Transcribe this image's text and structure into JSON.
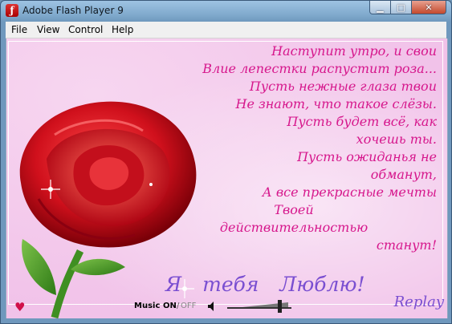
{
  "window": {
    "title": "Adobe Flash Player 9"
  },
  "menu": [
    "File",
    "View",
    "Control",
    "Help"
  ],
  "poem": [
    "Наступит утро, и свои",
    "Влие лепестки распустит роза...",
    "Пусть нежные глаза твои",
    "Не знают, что такое слёзы.",
    "Пусть будет всё, как",
    "хочешь ты.",
    "Пусть ожиданья не",
    "обманут,",
    "А все прекрасные мечты",
    "Твоей",
    "действительностью",
    "станут!"
  ],
  "love_text": "Я тебя Люблю!",
  "replay": "Replay",
  "controls": {
    "music": "Music",
    "on": "ON",
    "sep": "/",
    "off": "OFF",
    "volume_level": 0.85
  },
  "colors": {
    "poem": "#d6178c",
    "accent": "#7a4fd1",
    "rose": "#cc1020"
  }
}
